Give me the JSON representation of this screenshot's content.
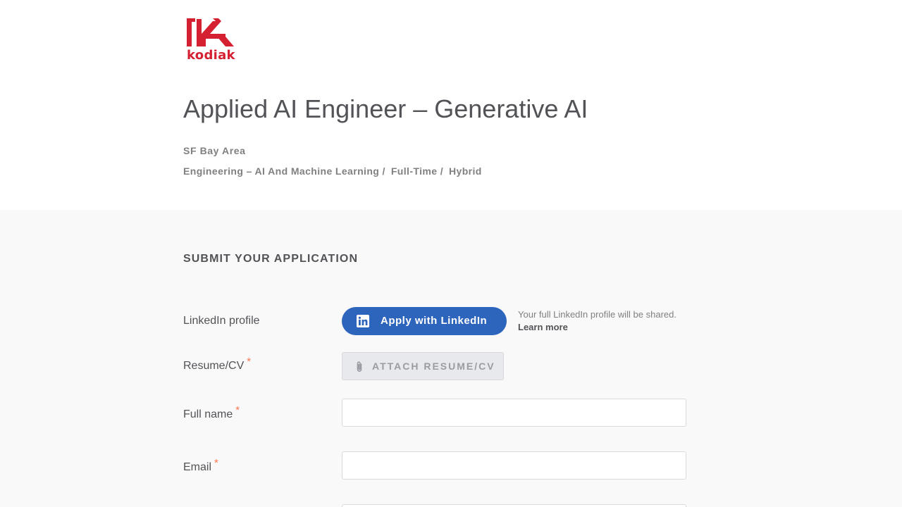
{
  "company": {
    "logo_text": "kodiak",
    "brand_color": "#d42030"
  },
  "job": {
    "title": "Applied AI Engineer – Generative AI",
    "location": "SF Bay Area",
    "categories": [
      {
        "label": "Engineering – AI And Machine Learning",
        "separator": "/"
      },
      {
        "label": "Full-Time",
        "separator": "/"
      },
      {
        "label": "Hybrid",
        "separator": ""
      }
    ]
  },
  "form": {
    "heading": "SUBMIT YOUR APPLICATION",
    "required_mark": "*",
    "linkedin": {
      "label": "LinkedIn profile",
      "button_label": "Apply with LinkedIn",
      "button_icon": "linkedin-icon",
      "note": "Your full LinkedIn profile will be shared.",
      "learn_more": "Learn more",
      "accent_color": "#2d64bc"
    },
    "resume": {
      "label": "Resume/CV",
      "button_label": "ATTACH RESUME/CV",
      "button_icon": "paperclip-icon"
    },
    "full_name": {
      "label": "Full name",
      "value": "",
      "placeholder": ""
    },
    "email": {
      "label": "Email",
      "value": "",
      "placeholder": ""
    },
    "required_color": "#ff794f"
  }
}
